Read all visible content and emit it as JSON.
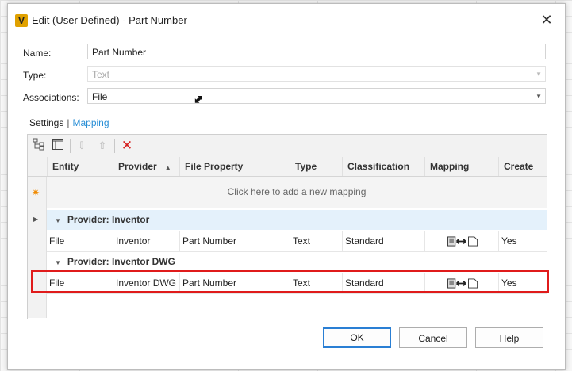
{
  "dialog": {
    "title": "Edit (User Defined) - Part Number",
    "app_icon_letter": "V"
  },
  "form": {
    "name_label": "Name:",
    "name_value": "Part Number",
    "type_label": "Type:",
    "type_value": "Text",
    "associations_label": "Associations:",
    "associations_value": "File"
  },
  "tabs": {
    "settings": "Settings",
    "separator": "|",
    "mapping": "Mapping"
  },
  "grid": {
    "columns": [
      "Entity",
      "Provider",
      "File Property",
      "Type",
      "Classification",
      "Mapping",
      "Create"
    ],
    "new_row_text": "Click here to add a new mapping",
    "groups": [
      {
        "label": "Provider: Inventor",
        "rows": [
          {
            "entity": "File",
            "provider": "Inventor",
            "file_property": "Part Number",
            "type": "Text",
            "classification": "Standard",
            "create": "Yes"
          }
        ]
      },
      {
        "label": "Provider: Inventor DWG",
        "rows": [
          {
            "entity": "File",
            "provider": "Inventor DWG",
            "file_property": "Part Number",
            "type": "Text",
            "classification": "Standard",
            "create": "Yes"
          }
        ]
      }
    ]
  },
  "buttons": {
    "ok": "OK",
    "cancel": "Cancel",
    "help": "Help"
  },
  "colors": {
    "accent": "#2a8fd6",
    "highlight_box": "#e01b1b",
    "delete_icon": "#d62020",
    "selected_group": "#e4f1fb"
  }
}
